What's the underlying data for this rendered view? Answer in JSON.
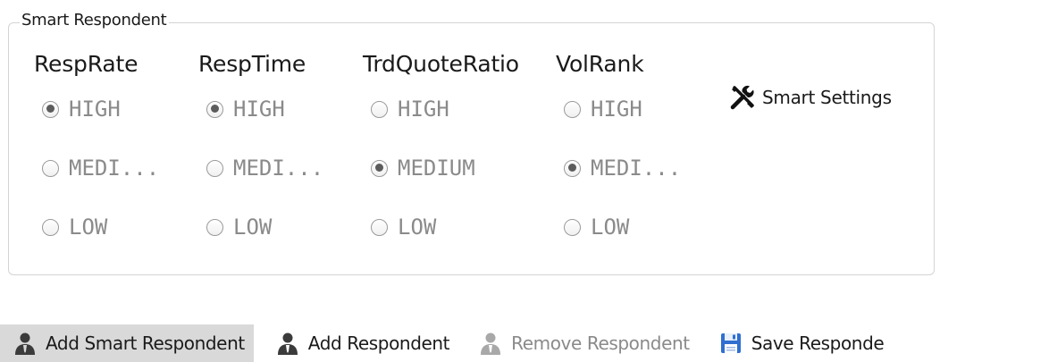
{
  "group": {
    "title": "Smart Respondent"
  },
  "columns": [
    {
      "header": "RespRate",
      "options": [
        {
          "label": "HIGH",
          "checked": true
        },
        {
          "label": "MEDI...",
          "checked": false
        },
        {
          "label": "LOW",
          "checked": false
        }
      ]
    },
    {
      "header": "RespTime",
      "options": [
        {
          "label": "HIGH",
          "checked": true
        },
        {
          "label": "MEDI...",
          "checked": false
        },
        {
          "label": "LOW",
          "checked": false
        }
      ]
    },
    {
      "header": "TrdQuoteRatio",
      "options": [
        {
          "label": "HIGH",
          "checked": false
        },
        {
          "label": "MEDIUM",
          "checked": true
        },
        {
          "label": "LOW",
          "checked": false
        }
      ]
    },
    {
      "header": "VolRank",
      "options": [
        {
          "label": "HIGH",
          "checked": false
        },
        {
          "label": "MEDI...",
          "checked": true
        },
        {
          "label": "LOW",
          "checked": false
        }
      ]
    }
  ],
  "smart_settings": {
    "label": "Smart Settings",
    "icon": "tools-icon"
  },
  "toolbar": {
    "add_smart_label": "Add Smart Respondent",
    "add_label": "Add Respondent",
    "remove_label": "Remove Respondent",
    "save_label": "Save Responde"
  },
  "colors": {
    "active_button_bg": "#d9d9d9",
    "disabled_text": "#8a8a8a",
    "save_icon_blue": "#2f6fd0"
  }
}
